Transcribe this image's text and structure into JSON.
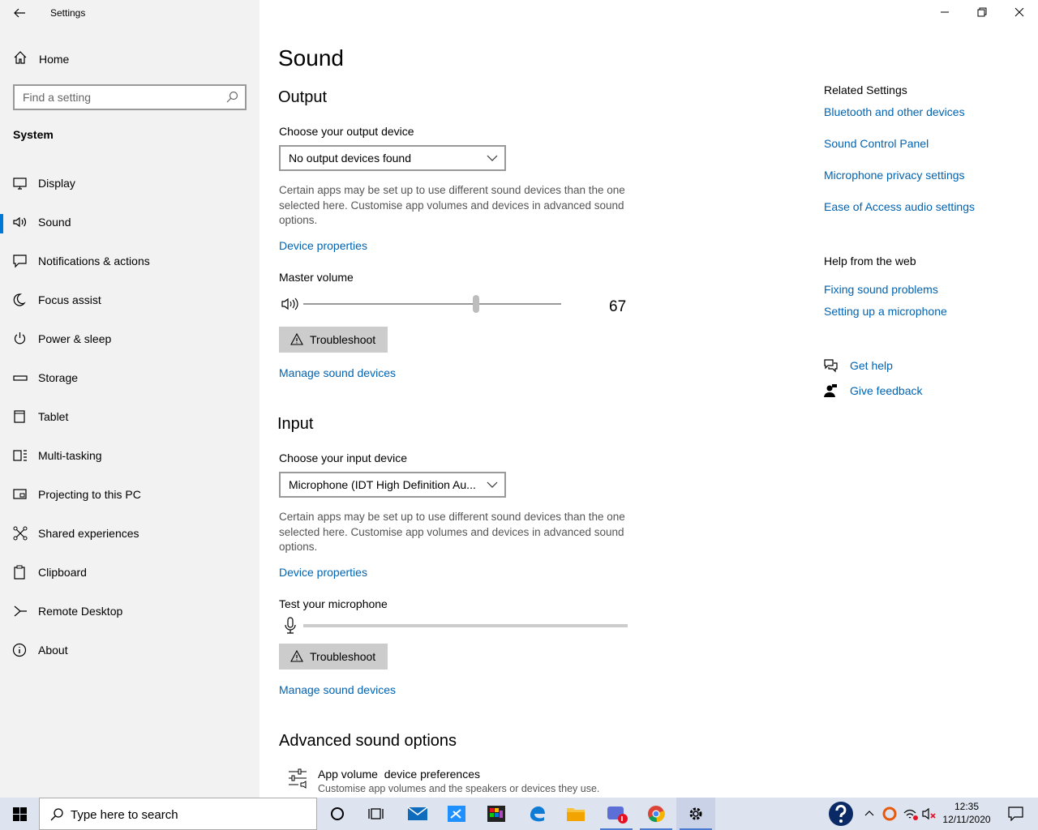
{
  "window": {
    "title": "Settings",
    "back_icon": "arrow-left-icon",
    "controls": [
      "minimize-icon",
      "restore-icon",
      "close-icon"
    ]
  },
  "sidebar": {
    "home_label": "Home",
    "search_placeholder": "Find a setting",
    "section": "System",
    "items": [
      {
        "label": "Display",
        "icon": "monitor-icon"
      },
      {
        "label": "Sound",
        "icon": "speaker-icon",
        "active": true
      },
      {
        "label": "Notifications & actions",
        "icon": "notification-icon"
      },
      {
        "label": "Focus assist",
        "icon": "moon-icon"
      },
      {
        "label": "Power & sleep",
        "icon": "power-icon"
      },
      {
        "label": "Storage",
        "icon": "storage-icon"
      },
      {
        "label": "Tablet",
        "icon": "tablet-icon"
      },
      {
        "label": "Multi-tasking",
        "icon": "multitask-icon"
      },
      {
        "label": "Projecting to this PC",
        "icon": "projector-icon"
      },
      {
        "label": "Shared experiences",
        "icon": "share-icon"
      },
      {
        "label": "Clipboard",
        "icon": "clipboard-icon"
      },
      {
        "label": "Remote Desktop",
        "icon": "remote-desktop-icon"
      },
      {
        "label": "About",
        "icon": "info-icon"
      }
    ]
  },
  "main": {
    "title": "Sound",
    "output": {
      "heading": "Output",
      "device_label": "Choose your output device",
      "device_value": "No output devices found",
      "description": "Certain apps may be set up to use different sound devices than the one selected here. Customise app volumes and devices in advanced sound options.",
      "device_properties": "Device properties",
      "volume_label": "Master volume",
      "volume_value": "67",
      "volume_fraction": 0.67,
      "troubleshoot": "Troubleshoot",
      "manage": "Manage sound devices"
    },
    "input": {
      "heading": "Input",
      "device_label": "Choose your input device",
      "device_value": "Microphone (IDT High Definition Au...",
      "description": "Certain apps may be set up to use different sound devices than the one selected here. Customise app volumes and devices in advanced sound options.",
      "device_properties": "Device properties",
      "test_label": "Test your microphone",
      "troubleshoot": "Troubleshoot",
      "manage": "Manage sound devices"
    },
    "advanced": {
      "heading": "Advanced sound options",
      "item_title": "App volume  device preferences",
      "item_desc": "Customise app volumes and the speakers or devices they use."
    }
  },
  "related": {
    "heading": "Related Settings",
    "links": [
      "Bluetooth and other devices",
      "Sound Control Panel",
      "Microphone privacy settings",
      "Ease of Access audio settings"
    ],
    "help_heading": "Help from the web",
    "help_links": [
      "Fixing sound problems",
      "Setting up a microphone"
    ],
    "get_help": "Get help",
    "give_feedback": "Give feedback"
  },
  "taskbar": {
    "search_placeholder": "Type here to search",
    "time": "12:35",
    "date": "12/11/2020",
    "accent": "#0078d7"
  }
}
